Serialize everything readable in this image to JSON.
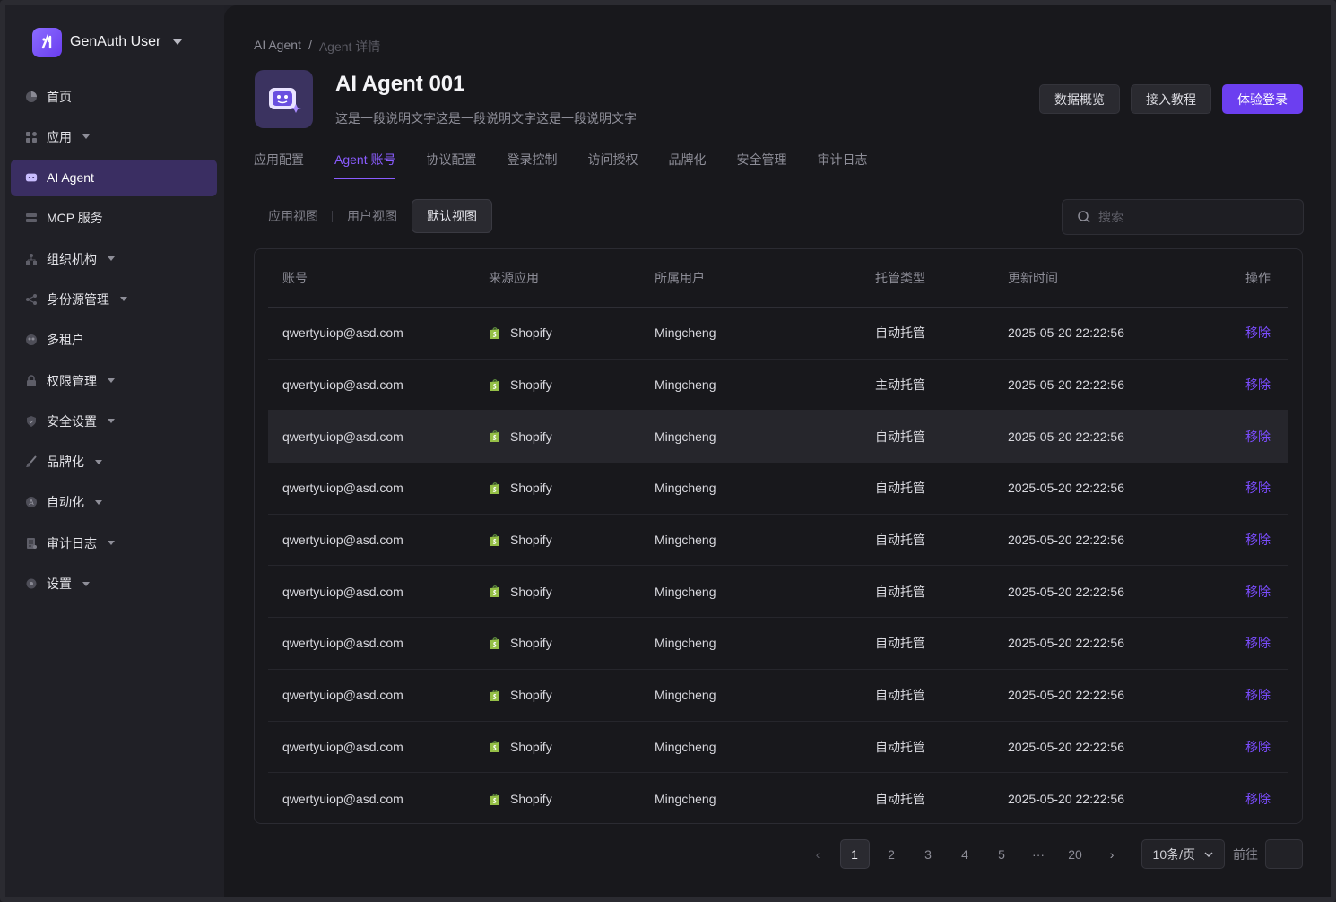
{
  "brand": {
    "name": "GenAuth User"
  },
  "sidebar": {
    "items": [
      {
        "label": "首页",
        "icon": "pie-chart-icon",
        "caret": false,
        "active": false
      },
      {
        "label": "应用",
        "icon": "apps-icon",
        "caret": true,
        "active": false
      },
      {
        "label": "AI Agent",
        "icon": "robot-icon",
        "caret": false,
        "active": true
      },
      {
        "label": "MCP 服务",
        "icon": "server-icon",
        "caret": false,
        "active": false
      },
      {
        "label": "组织机构",
        "icon": "org-icon",
        "caret": true,
        "active": false
      },
      {
        "label": "身份源管理",
        "icon": "share-icon",
        "caret": true,
        "active": false
      },
      {
        "label": "多租户",
        "icon": "tenant-icon",
        "caret": false,
        "active": false
      },
      {
        "label": "权限管理",
        "icon": "lock-icon",
        "caret": true,
        "active": false
      },
      {
        "label": "安全设置",
        "icon": "shield-icon",
        "caret": true,
        "active": false
      },
      {
        "label": "品牌化",
        "icon": "brush-icon",
        "caret": true,
        "active": false
      },
      {
        "label": "自动化",
        "icon": "auto-icon",
        "caret": true,
        "active": false
      },
      {
        "label": "审计日志",
        "icon": "log-icon",
        "caret": true,
        "active": false
      },
      {
        "label": "设置",
        "icon": "gear-icon",
        "caret": true,
        "active": false
      }
    ]
  },
  "breadcrumb": {
    "root": "AI Agent",
    "sep": "/",
    "current": "Agent 详情"
  },
  "agent": {
    "title": "AI Agent 001",
    "description": "这是一段说明文字这是一段说明文字这是一段说明文字"
  },
  "header_buttons": {
    "overview": "数据概览",
    "tutorial": "接入教程",
    "try_login": "体验登录"
  },
  "tabs": [
    "应用配置",
    "Agent 账号",
    "协议配置",
    "登录控制",
    "访问授权",
    "品牌化",
    "安全管理",
    "审计日志"
  ],
  "active_tab": "Agent 账号",
  "views": {
    "app": "应用视图",
    "user": "用户视图",
    "default": "默认视图"
  },
  "search": {
    "placeholder": "搜索"
  },
  "table": {
    "headers": [
      "账号",
      "来源应用",
      "所属用户",
      "托管类型",
      "更新时间",
      "操作"
    ],
    "rows": [
      {
        "account": "qwertyuiop@asd.com",
        "app": "Shopify",
        "user": "Mingcheng",
        "type": "自动托管",
        "time": "2025-05-20 22:22:56",
        "action": "移除"
      },
      {
        "account": "qwertyuiop@asd.com",
        "app": "Shopify",
        "user": "Mingcheng",
        "type": "主动托管",
        "time": "2025-05-20 22:22:56",
        "action": "移除"
      },
      {
        "account": "qwertyuiop@asd.com",
        "app": "Shopify",
        "user": "Mingcheng",
        "type": "自动托管",
        "time": "2025-05-20 22:22:56",
        "action": "移除"
      },
      {
        "account": "qwertyuiop@asd.com",
        "app": "Shopify",
        "user": "Mingcheng",
        "type": "自动托管",
        "time": "2025-05-20 22:22:56",
        "action": "移除"
      },
      {
        "account": "qwertyuiop@asd.com",
        "app": "Shopify",
        "user": "Mingcheng",
        "type": "自动托管",
        "time": "2025-05-20 22:22:56",
        "action": "移除"
      },
      {
        "account": "qwertyuiop@asd.com",
        "app": "Shopify",
        "user": "Mingcheng",
        "type": "自动托管",
        "time": "2025-05-20 22:22:56",
        "action": "移除"
      },
      {
        "account": "qwertyuiop@asd.com",
        "app": "Shopify",
        "user": "Mingcheng",
        "type": "自动托管",
        "time": "2025-05-20 22:22:56",
        "action": "移除"
      },
      {
        "account": "qwertyuiop@asd.com",
        "app": "Shopify",
        "user": "Mingcheng",
        "type": "自动托管",
        "time": "2025-05-20 22:22:56",
        "action": "移除"
      },
      {
        "account": "qwertyuiop@asd.com",
        "app": "Shopify",
        "user": "Mingcheng",
        "type": "自动托管",
        "time": "2025-05-20 22:22:56",
        "action": "移除"
      },
      {
        "account": "qwertyuiop@asd.com",
        "app": "Shopify",
        "user": "Mingcheng",
        "type": "自动托管",
        "time": "2025-05-20 22:22:56",
        "action": "移除"
      }
    ]
  },
  "pagination": {
    "pages": [
      "1",
      "2",
      "3",
      "4",
      "5",
      "···",
      "20"
    ],
    "current": "1",
    "page_size": "10条/页",
    "goto_label": "前往"
  },
  "colors": {
    "accent": "#6c3ff0",
    "link": "#7b4dff",
    "shopify": "#95bf47"
  }
}
